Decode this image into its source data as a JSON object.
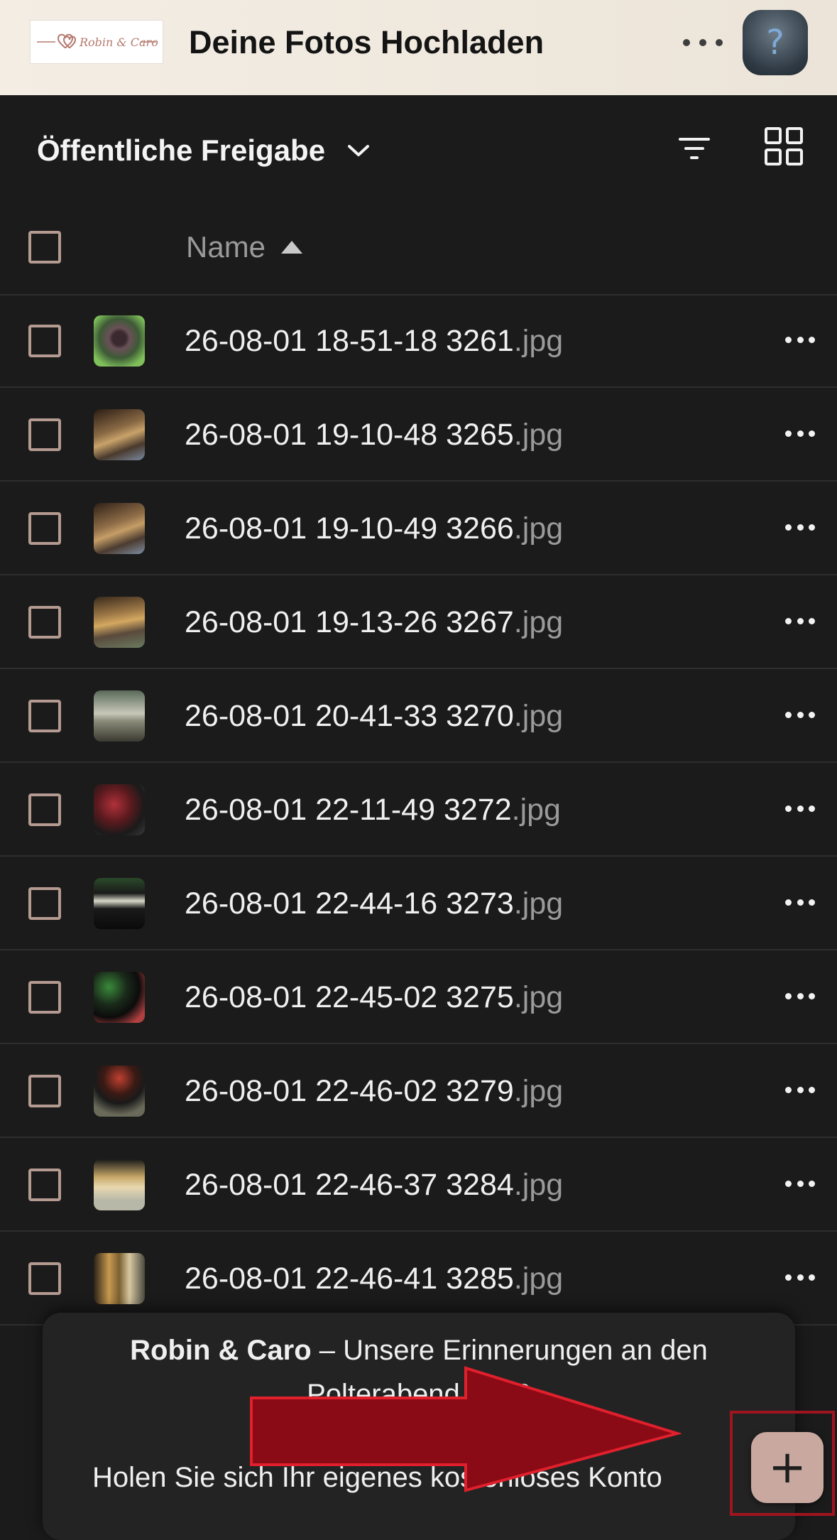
{
  "header": {
    "logo_text": "Robin & Caro",
    "title": "Deine Fotos Hochladen",
    "more_icon": "more-horizontal-icon",
    "help_label": "?"
  },
  "toolbar": {
    "share_label": "Öffentliche Freigabe",
    "dropdown_icon": "chevron-down-icon",
    "filter_icon": "filter-icon",
    "view_icon": "grid-view-icon"
  },
  "table": {
    "name_header": "Name",
    "sort": "ascending",
    "rows": [
      {
        "base": "26-08-01 18-51-18 3261",
        "ext": ".jpg"
      },
      {
        "base": "26-08-01 19-10-48 3265",
        "ext": ".jpg"
      },
      {
        "base": "26-08-01 19-10-49 3266",
        "ext": ".jpg"
      },
      {
        "base": "26-08-01 19-13-26 3267",
        "ext": ".jpg"
      },
      {
        "base": "26-08-01 20-41-33 3270",
        "ext": ".jpg"
      },
      {
        "base": "26-08-01 22-11-49 3272",
        "ext": ".jpg"
      },
      {
        "base": "26-08-01 22-44-16 3273",
        "ext": ".jpg"
      },
      {
        "base": "26-08-01 22-45-02 3275",
        "ext": ".jpg"
      },
      {
        "base": "26-08-01 22-46-02 3279",
        "ext": ".jpg"
      },
      {
        "base": "26-08-01 22-46-37 3284",
        "ext": ".jpg"
      },
      {
        "base": "26-08-01 22-46-41 3285",
        "ext": ".jpg"
      }
    ]
  },
  "banner": {
    "brand": "Robin & Caro",
    "separator": " – ",
    "text": "Unsere Erinnerungen an den Polterabend 2026",
    "cta": "Holen Sie sich Ihr eigenes kostenloses Konto"
  },
  "fab": {
    "label": "+",
    "icon": "plus-icon"
  },
  "colors": {
    "accent": "#c9a99f",
    "checkbox_border": "#b49a90",
    "annotation_red": "#8a0a16",
    "background": "#1b1b1b"
  }
}
